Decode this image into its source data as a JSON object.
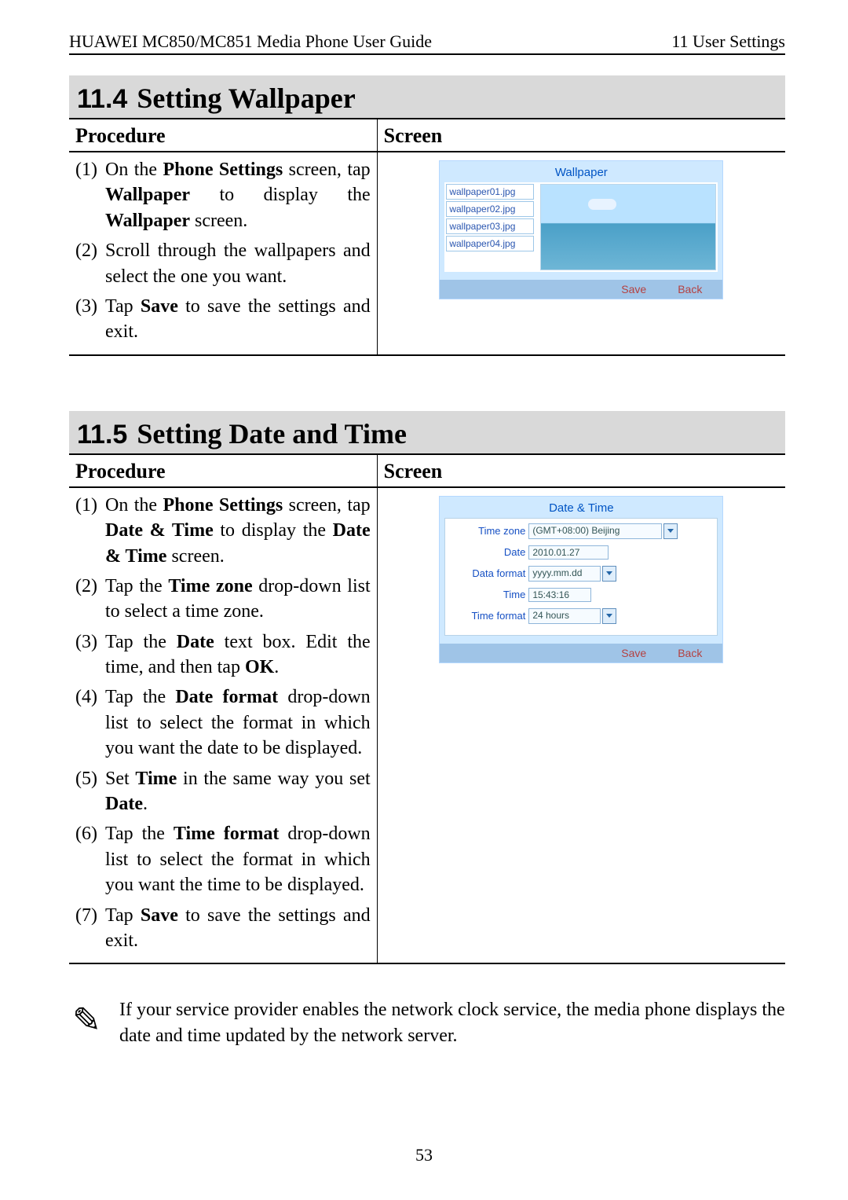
{
  "header": {
    "left": "HUAWEI MC850/MC851 Media Phone User Guide",
    "right": "11 User Settings"
  },
  "sections": [
    {
      "num": "11.4",
      "title": "Setting Wallpaper"
    },
    {
      "num": "11.5",
      "title": "Setting Date and Time"
    }
  ],
  "th": {
    "proc": "Procedure",
    "screen": "Screen"
  },
  "wallpaper": {
    "steps": [
      {
        "n": "(1)",
        "pre": "On the ",
        "b1": "Phone Settings",
        "mid1": " screen, tap ",
        "b2": "Wallpaper",
        "mid2": " to display the ",
        "b3": "Wallpaper",
        "post": " screen."
      },
      {
        "n": "(2)",
        "text": "Scroll through the wallpapers and select the one you want."
      },
      {
        "n": "(3)",
        "pre": "Tap ",
        "b1": "Save",
        "post": " to save the settings and exit."
      }
    ],
    "screen": {
      "title": "Wallpaper",
      "items": [
        "wallpaper01.jpg",
        "wallpaper02.jpg",
        "wallpaper03.jpg",
        "wallpaper04.jpg"
      ],
      "save": "Save",
      "back": "Back"
    }
  },
  "datetime": {
    "steps_labels": {
      "s1n": "(1)",
      "s2n": "(2)",
      "s3n": "(3)",
      "s4n": "(4)",
      "s5n": "(5)",
      "s6n": "(6)",
      "s7n": "(7)"
    },
    "s1": {
      "pre": "On the ",
      "b1": "Phone Settings",
      "mid": " screen, tap ",
      "b2": "Date & Time",
      "mid2": " to display the ",
      "b3": "Date & Time",
      "post": " screen."
    },
    "s2": {
      "pre": "Tap the ",
      "b1": "Time zone",
      "post": " drop-down list to select a time zone."
    },
    "s3": {
      "pre": "Tap the ",
      "b1": "Date",
      "mid": " text box. Edit the time, and then tap ",
      "b2": "OK",
      "post": "."
    },
    "s4": {
      "pre": "Tap the ",
      "b1": "Date format",
      "post": " drop-down list to select the format in which you want the date to be displayed."
    },
    "s5": {
      "pre": "Set ",
      "b1": "Time",
      "mid": " in the same way you set ",
      "b2": "Date",
      "post": "."
    },
    "s6": {
      "pre": "Tap the ",
      "b1": "Time format",
      "post": " drop-down list to select the format in which you want the time to be displayed."
    },
    "s7": {
      "pre": "Tap ",
      "b1": "Save",
      "post": " to save the settings and exit."
    },
    "screen": {
      "title": "Date & Time",
      "tz_label": "Time zone",
      "tz_val": "(GMT+08:00) Beijing",
      "date_label": "Date",
      "date_val": "2010.01.27",
      "datafmt_label": "Data format",
      "datafmt_val": "yyyy.mm.dd",
      "time_label": "Time",
      "time_val": "15:43:16",
      "timefmt_label": "Time format",
      "timefmt_val": "24 hours",
      "save": "Save",
      "back": "Back"
    }
  },
  "note": "If your service provider enables the network clock service, the media phone displays the date and time updated by the network server.",
  "page_number": "53"
}
